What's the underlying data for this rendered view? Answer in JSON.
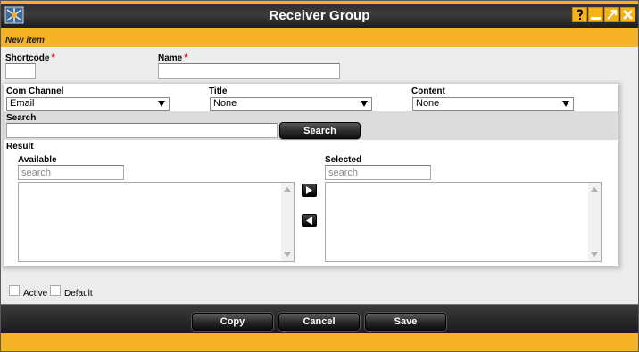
{
  "window": {
    "title": "Receiver Group"
  },
  "form": {
    "section_label": "New item",
    "shortcode": {
      "label": "Shortcode",
      "value": ""
    },
    "name": {
      "label": "Name",
      "value": ""
    },
    "required_mark": "*"
  },
  "filters": {
    "com_channel": {
      "label": "Com Channel",
      "value": "Email"
    },
    "title": {
      "label": "Title",
      "value": "None"
    },
    "content": {
      "label": "Content",
      "value": "None"
    }
  },
  "search": {
    "label": "Search",
    "value": "",
    "button": "Search"
  },
  "result": {
    "label": "Result",
    "available": {
      "label": "Available",
      "filter_placeholder": "search",
      "items": []
    },
    "selected": {
      "label": "Selected",
      "filter_placeholder": "search",
      "items": []
    }
  },
  "flags": {
    "active": {
      "label": "Active",
      "checked": false
    },
    "default": {
      "label": "Default",
      "checked": false
    }
  },
  "footer": {
    "copy": "Copy",
    "cancel": "Cancel",
    "save": "Save"
  },
  "icons": [
    "app-logo-icon",
    "help-icon",
    "minimize-icon",
    "maximize-icon",
    "close-icon",
    "move-right-icon",
    "move-left-icon",
    "chevron-down-icon"
  ],
  "colors": {
    "accent": "#f6b325",
    "titlebar": "#2e2e2e",
    "required": "#e21e1e"
  }
}
